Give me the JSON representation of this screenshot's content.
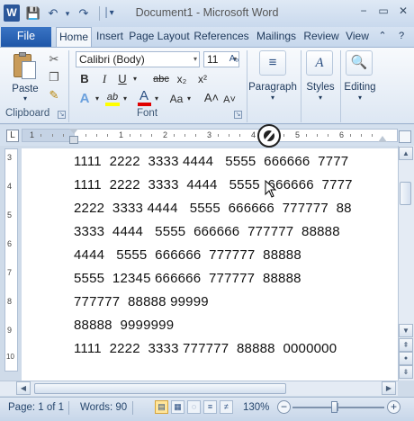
{
  "title_bar": {
    "document_title": "Document1 - Microsoft Word",
    "app_logo_letter": "W",
    "qat": {
      "save_icon": "💾",
      "undo_icon": "↶",
      "undo_dd": "▾",
      "redo_icon": "↷",
      "customize_icon": "│▾"
    },
    "window": {
      "minimize": "−",
      "maximize": "▭",
      "close": "✕"
    }
  },
  "tabs": {
    "file": "File",
    "home": "Home",
    "insert": "Insert",
    "page_layout": "Page Layout",
    "references": "References",
    "mailings": "Mailings",
    "review": "Review",
    "view": "View",
    "help_icon": "?",
    "collapse_icon": "⌃"
  },
  "ribbon": {
    "clipboard": {
      "paste": "Paste",
      "paste_dd": "▾",
      "label": "Clipboard",
      "cut_icon": "✂",
      "copy_icon": "❐",
      "painter_icon": "✎"
    },
    "font": {
      "label": "Font",
      "font_name": "Calibri (Body)",
      "font_size": "11",
      "bold": "B",
      "italic": "I",
      "underline": "U",
      "strike": "abc",
      "subscript": "x₂",
      "superscript": "x²",
      "effects": "A",
      "highlight": "ab",
      "color": "A",
      "case": "Aa",
      "grow": "A˄",
      "shrink": "A˅",
      "clear": "Aₒ",
      "dd": "▾"
    },
    "paragraph": {
      "label": "Paragraph",
      "dd": "▾"
    },
    "styles": {
      "label": "Styles",
      "dd": "▾"
    },
    "editing": {
      "label": "Editing",
      "dd": "▾"
    }
  },
  "ruler": {
    "tab_selector": "L",
    "numbers": [
      "1",
      "1",
      "2",
      "3",
      "4",
      "5",
      "6"
    ]
  },
  "vruler": {
    "numbers": [
      "3",
      "4",
      "5",
      "6",
      "7",
      "8",
      "9",
      "10"
    ]
  },
  "document": {
    "lines": [
      "1111  2222  3333 4444   5555  666666  7777",
      "1111  2222  3333  4444   5555  666666  7777",
      "2222  3333 4444   5555  666666  777777  88",
      "3333  4444   5555  666666  777777  88888",
      "4444   5555  666666  777777  88888",
      "5555  12345 666666  777777  88888",
      "777777  88888 99999",
      "88888  9999999",
      "1111  2222  3333 777777  88888  0000000"
    ]
  },
  "scroll": {
    "up": "▲",
    "down": "▼",
    "left": "◀",
    "right": "▶",
    "prev_page": "⇞",
    "select_browse": "●",
    "next_page": "⇟"
  },
  "status_bar": {
    "page": "Page: 1 of 1",
    "words": "Words: 90",
    "zoom": "130%",
    "zoom_minus": "−",
    "zoom_plus": "+",
    "zoom_level": 0.46
  },
  "colors": {
    "accent": "#2b579a",
    "highlight": "#ffff00",
    "font_color": "#e00000"
  }
}
